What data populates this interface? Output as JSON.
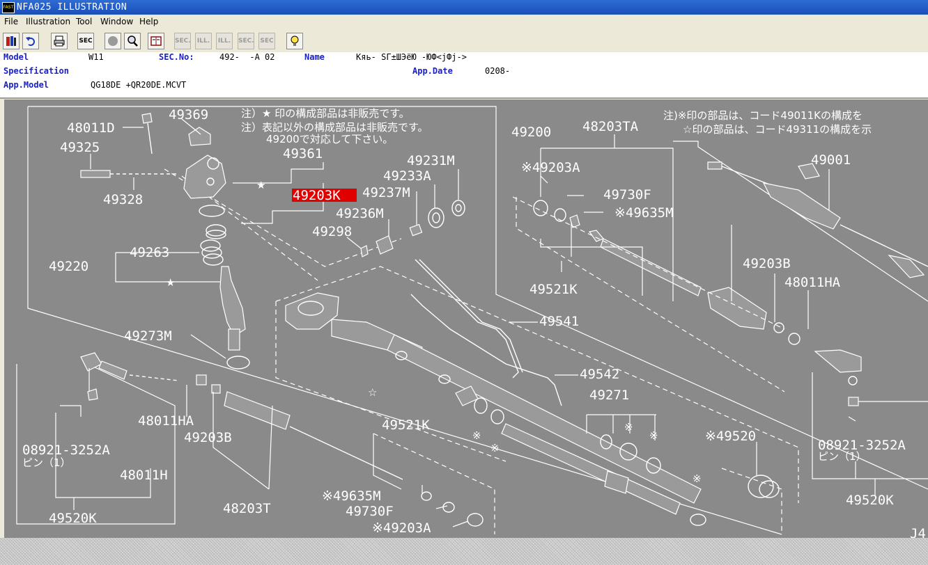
{
  "window": {
    "title": "NFA025 ILLUSTRATION",
    "icon": "app-icon",
    "icon_text": "FAST"
  },
  "menu": [
    "File",
    "Illustration",
    "Tool",
    "Window",
    "Help"
  ],
  "toolbar": {
    "buttons": [
      {
        "name": "catalog-button",
        "icon": "catalog-icon",
        "text": ""
      },
      {
        "name": "undo-button",
        "icon": "undo-icon",
        "text": ""
      },
      {
        "name": "print-button",
        "icon": "printer-icon",
        "text": ""
      },
      {
        "name": "sec-button",
        "icon": "",
        "text": "SEC"
      },
      {
        "name": "circle-button",
        "icon": "circle-icon",
        "text": ""
      },
      {
        "name": "zoom-button",
        "icon": "magnifier-icon",
        "text": ""
      },
      {
        "name": "book-button",
        "icon": "book-icon",
        "text": ""
      },
      {
        "name": "prev-sec-button",
        "icon": "",
        "text": "SEC."
      },
      {
        "name": "prev-ill-button",
        "icon": "",
        "text": "ILL."
      },
      {
        "name": "next-ill-button",
        "icon": "",
        "text": "ILL."
      },
      {
        "name": "next-sec-button",
        "icon": "",
        "text": "SEC."
      },
      {
        "name": "sec-query-button",
        "icon": "",
        "text": "SEC"
      },
      {
        "name": "hint-button",
        "icon": "lightbulb-icon",
        "text": ""
      }
    ]
  },
  "info": {
    "model_label": "Model",
    "model_value": "W11",
    "sec_label": "SEC.No:",
    "sec_value": "492-  -A 02",
    "name_label": "Name",
    "name_value": "Кяь- SГ±ШЭёЮ -ЮФ<jФj->",
    "spec_label": "Specification",
    "appdate_label": "App.Date",
    "appdate_value": "0208-",
    "appmodel_label": "App.Model",
    "appmodel_value": "QG18DE +QR20DE.MCVT"
  },
  "colors": {
    "canvas_bg": "#8a8a8a",
    "highlight": "#e10000",
    "label_blue": "#1b20c8"
  },
  "illustration": {
    "notes": [
      "注）★ 印の構成部品は非販売です。",
      "注）表記以外の構成部品は非販売です。",
      "49200で対応して下さい。",
      "注)※印の部品は、コード49011Kの構成を",
      "☆印の部品は、コード49311の構成を示"
    ],
    "highlighted_part": "49203K",
    "parts": {
      "p49369": "49369",
      "p48011D": "48011D",
      "p49325": "49325",
      "p49328": "49328",
      "p49361": "49361",
      "p49231M": "49231M",
      "p49233A": "49233A",
      "p49237M": "49237M",
      "p49236M": "49236M",
      "p49298": "49298",
      "p49263": "49263",
      "p49220": "49220",
      "p49273M": "49273M",
      "p48011HA_l": "48011HA",
      "p49203B_l": "49203B",
      "p08921_l": "08921-3252A",
      "pin_l": "ピン（1）",
      "p48011H": "48011H",
      "p49520K_l": "49520K",
      "p48203T": "48203T",
      "p49521K_b": "49521K",
      "p49635M_b": "※49635M",
      "p49730F_b": "49730F",
      "p49203A_b": "※49203A",
      "p49200": "49200",
      "p48203TA": "48203TA",
      "p49203A_t": "※49203A",
      "p49730F_t": "49730F",
      "p49635M_t": "※49635M",
      "p49521K_t": "49521K",
      "p49001": "49001",
      "p49203B_r": "49203B",
      "p48011HA_r": "48011HA",
      "p49541": "49541",
      "p49542": "49542",
      "p49271": "49271",
      "p49520": "※49520",
      "p08921_r": "08921-3252A",
      "pin_r": "ピン（1）",
      "p49520K_r": "49520K",
      "p_j4": "J4"
    },
    "marks": {
      "star": "★",
      "kome": "※",
      "open_star": "☆"
    }
  }
}
